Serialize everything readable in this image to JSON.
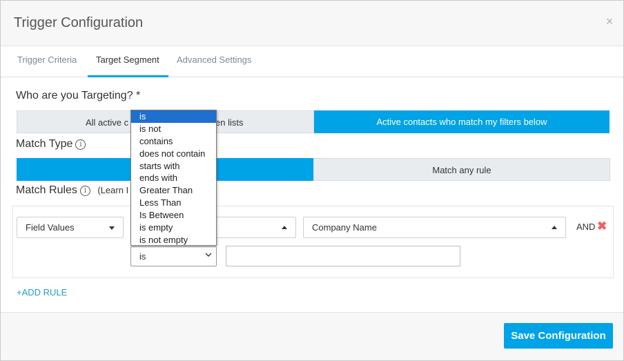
{
  "modal": {
    "title": "Trigger Configuration",
    "close_glyph": "×"
  },
  "tabs": [
    {
      "label": "Trigger Criteria",
      "active": false
    },
    {
      "label": "Target Segment",
      "active": true
    },
    {
      "label": "Advanced Settings",
      "active": false
    }
  ],
  "targeting": {
    "label": "Who are you Targeting? *",
    "option_all": "All active c",
    "option_all_tail": "en lists",
    "option_filters": "Active contacts who match my filters below"
  },
  "match_type": {
    "label": "Match Type",
    "option_all": "",
    "option_any": "Match any rule"
  },
  "match_rules": {
    "label": "Match Rules",
    "learn": "(Learn I"
  },
  "rule": {
    "field_type": "Field Values",
    "field_name": "Company Name",
    "operator": "is",
    "value": "",
    "conjunction": "AND"
  },
  "operator_options": [
    "is",
    "is not",
    "contains",
    "does not contain",
    "starts with",
    "ends with",
    "Greater Than",
    "Less Than",
    "Is Between",
    "is empty",
    "is not empty"
  ],
  "add_rule": "+ADD RULE",
  "footer": {
    "save_label": "Save Configuration"
  },
  "colors": {
    "accent": "#00a3e6",
    "selected_option": "#1f6fce",
    "remove": "#f06262"
  }
}
